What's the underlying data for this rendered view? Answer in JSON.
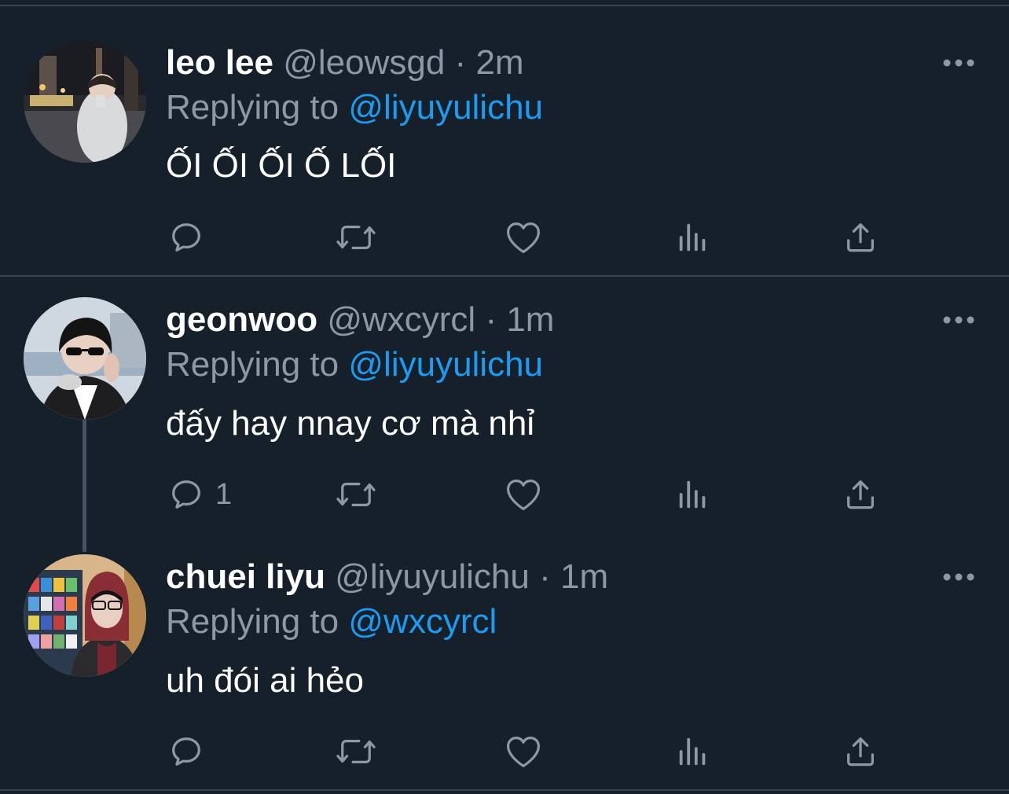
{
  "tweets": [
    {
      "name": "leo lee",
      "handle": "@leowsgd",
      "separator": "·",
      "time": "2m",
      "replying_label": "Replying to",
      "replying_to": "@liyuyulichu",
      "text": "ỐI ỐI ỐI Ố LỐI",
      "reply_count": ""
    },
    {
      "name": "geonwoo",
      "handle": "@wxcyrcl",
      "separator": "·",
      "time": "1m",
      "replying_label": "Replying to",
      "replying_to": "@liyuyulichu",
      "text": "đấy hay nnay cơ mà nhỉ",
      "reply_count": "1"
    },
    {
      "name": "chuei liyu",
      "handle": "@liyuyulichu",
      "separator": "·",
      "time": "1m",
      "replying_label": "Replying to",
      "replying_to": "@wxcyrcl",
      "text": "uh đói ai hẻo",
      "reply_count": ""
    }
  ],
  "icons": {
    "reply": "reply-icon",
    "retweet": "retweet-icon",
    "like": "heart-icon",
    "views": "views-icon",
    "share": "share-icon",
    "more": "more-icon"
  },
  "colors": {
    "background": "#15202b",
    "divider": "#38444d",
    "muted_text": "#8b98a5",
    "mention": "#1d9bf0",
    "thread_line": "#425566"
  }
}
